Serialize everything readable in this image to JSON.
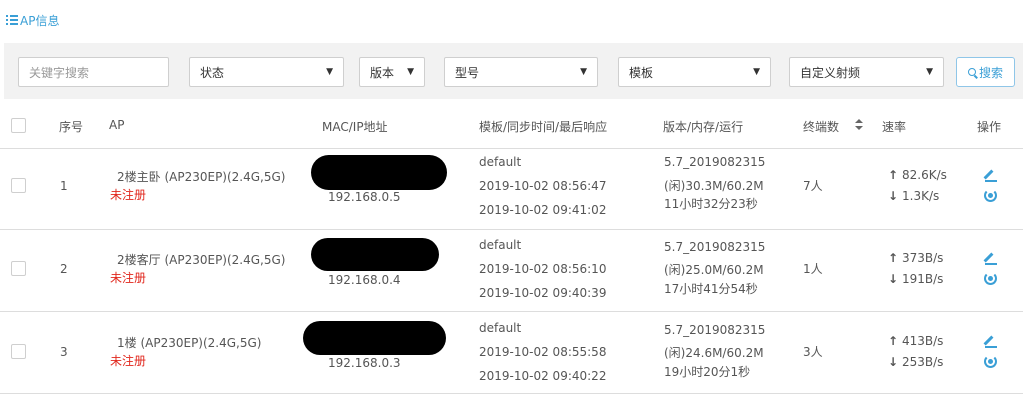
{
  "section": {
    "title": "AP信息"
  },
  "filters": {
    "keyword_placeholder": "关键字搜索",
    "status": "状态",
    "version": "版本",
    "model": "型号",
    "template": "模板",
    "rf": "自定义射频",
    "search_label": "搜索"
  },
  "columns": {
    "index": "序号",
    "ap": "AP",
    "mac_ip": "MAC/IP地址",
    "template_sync": "模板/同步时间/最后响应",
    "version_mem": "版本/内存/运行",
    "clients": "终端数",
    "rate": "速率",
    "ops": "操作"
  },
  "rows": [
    {
      "index": "1",
      "name": "2楼主卧 (AP230EP)(2.4G,5G)",
      "status": "未注册",
      "ip": "192.168.0.5",
      "template": "default",
      "sync_time": "2019-10-02 08:56:47",
      "last_response": "2019-10-02 09:41:02",
      "version": "5.7_2019082315",
      "memory": "(闲)30.3M/60.2M",
      "uptime": "11小时32分23秒",
      "clients": "7人",
      "up_rate": "82.6K/s",
      "down_rate": "1.3K/s"
    },
    {
      "index": "2",
      "name": "2楼客厅 (AP230EP)(2.4G,5G)",
      "status": "未注册",
      "ip": "192.168.0.4",
      "template": "default",
      "sync_time": "2019-10-02 08:56:10",
      "last_response": "2019-10-02 09:40:39",
      "version": "5.7_2019082315",
      "memory": "(闲)25.0M/60.2M",
      "uptime": "17小时41分54秒",
      "clients": "1人",
      "up_rate": "373B/s",
      "down_rate": "191B/s"
    },
    {
      "index": "3",
      "name": "1楼 (AP230EP)(2.4G,5G)",
      "status": "未注册",
      "ip": "192.168.0.3",
      "template": "default",
      "sync_time": "2019-10-02 08:55:58",
      "last_response": "2019-10-02 09:40:22",
      "version": "5.7_2019082315",
      "memory": "(闲)24.6M/60.2M",
      "uptime": "19小时20分1秒",
      "clients": "3人",
      "up_rate": "413B/s",
      "down_rate": "253B/s"
    }
  ],
  "icons": {
    "up": "↑",
    "down": "↓",
    "caret": "▼"
  }
}
